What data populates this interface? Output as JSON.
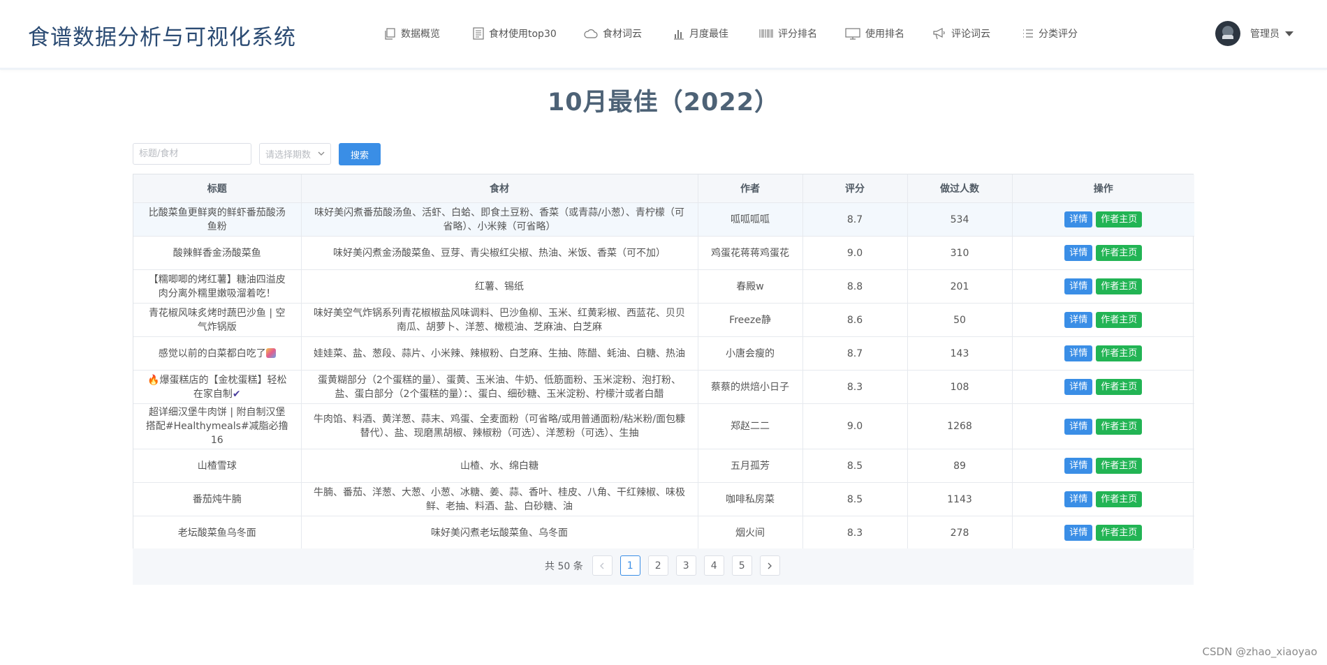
{
  "header": {
    "brand": "食谱数据分析与可视化系统",
    "nav": [
      {
        "label": "数据概览",
        "icon": "copy-icon"
      },
      {
        "label": "食材使用top30",
        "icon": "document-list-icon"
      },
      {
        "label": "食材词云",
        "icon": "cloud-icon"
      },
      {
        "label": "月度最佳",
        "icon": "bar-chart-icon"
      },
      {
        "label": "评分排名",
        "icon": "barcode-icon"
      },
      {
        "label": "使用排名",
        "icon": "monitor-icon"
      },
      {
        "label": "评论词云",
        "icon": "megaphone-icon"
      },
      {
        "label": "分类评分",
        "icon": "list-icon"
      }
    ],
    "user": {
      "name": "管理员"
    }
  },
  "page_title": "10月最佳（2022）",
  "search": {
    "placeholder": "标题/食材",
    "select_placeholder": "请选择期数",
    "button": "搜索"
  },
  "table": {
    "columns": [
      "标题",
      "食材",
      "作者",
      "评分",
      "做过人数",
      "操作"
    ],
    "rows": [
      {
        "title": "比酸菜鱼更鲜爽的鲜虾番茄酸汤鱼粉",
        "ingredients": "味好美闪煮番茄酸汤鱼、活虾、白蛤、即食土豆粉、香菜（或青蒜/小葱）、青柠檬（可省略）、小米辣（可省略）",
        "author": "呱呱呱呱",
        "score": "8.7",
        "count": "534"
      },
      {
        "title": "酸辣鲜香金汤酸菜鱼",
        "ingredients": "味好美闪煮金汤酸菜鱼、豆芽、青尖椒红尖椒、热油、米饭、香菜（可不加）",
        "author": "鸡蛋花蒋蒋鸡蛋花",
        "score": "9.0",
        "count": "310"
      },
      {
        "title": "【糯唧唧的烤红薯】糖油四溢皮肉分离外糯里嫩吸溜着吃！",
        "ingredients": "红薯、锡纸",
        "author": "春殿w",
        "score": "8.8",
        "count": "201"
      },
      {
        "title": "青花椒风味炙烤时蔬巴沙鱼 | 空气炸锅版",
        "ingredients": "味好美空气炸锅系列青花椒椒盐风味调料、巴沙鱼柳、玉米、红黄彩椒、西蓝花、贝贝南瓜、胡萝卜、洋葱、橄榄油、芝麻油、白芝麻",
        "author": "Freeze静",
        "score": "8.6",
        "count": "50"
      },
      {
        "title": "感觉以前的白菜都白吃了",
        "ingredients": "娃娃菜、盐、葱段、蒜片、小米辣、辣椒粉、白芝麻、生抽、陈醋、蚝油、白糖、热油",
        "author": "小唐会瘦的",
        "score": "8.7",
        "count": "143"
      },
      {
        "title": "爆蛋糕店的【金枕蛋糕】轻松在家自制",
        "ingredients": "蛋黄糊部分（2个蛋糕的量）、蛋黄、玉米油、牛奶、低筋面粉、玉米淀粉、泡打粉、盐、蛋白部分（2个蛋糕的量）：、蛋白、细砂糖、玉米淀粉、柠檬汁或者白醋",
        "author": "蔡蔡的烘焙小日子",
        "score": "8.3",
        "count": "108"
      },
      {
        "title": "超详细汉堡牛肉饼 | 附自制汉堡搭配#Healthymeals#减脂必撸16",
        "ingredients": "牛肉馅、料酒、黄洋葱、蒜末、鸡蛋、全麦面粉（可省略/或用普通面粉/粘米粉/面包糠替代）、盐、现磨黑胡椒、辣椒粉（可选）、洋葱粉（可选）、生抽",
        "author": "郑赵二二",
        "score": "9.0",
        "count": "1268"
      },
      {
        "title": "山楂雪球",
        "ingredients": "山楂、水、绵白糖",
        "author": "五月孤芳",
        "score": "8.5",
        "count": "89"
      },
      {
        "title": "番茄炖牛腩",
        "ingredients": "牛腩、番茄、洋葱、大葱、小葱、冰糖、姜、蒜、香叶、桂皮、八角、干红辣椒、味极鲜、老抽、料酒、盐、白砂糖、油",
        "author": "咖啡私房菜",
        "score": "8.5",
        "count": "1143"
      },
      {
        "title": "老坛酸菜鱼乌冬面",
        "ingredients": "味好美闪煮老坛酸菜鱼、乌冬面",
        "author": "烟火间",
        "score": "8.3",
        "count": "278"
      }
    ],
    "action_detail": "详情",
    "action_author": "作者主页"
  },
  "pagination": {
    "total": "共 50 条",
    "pages": [
      "1",
      "2",
      "3",
      "4",
      "5"
    ],
    "current": "1"
  },
  "watermark": "CSDN @zhao_xiaoyao",
  "colors": {
    "brand": "#2b4b73",
    "primary": "#3a8ee6",
    "success": "#22b454",
    "title": "#4d6276"
  }
}
